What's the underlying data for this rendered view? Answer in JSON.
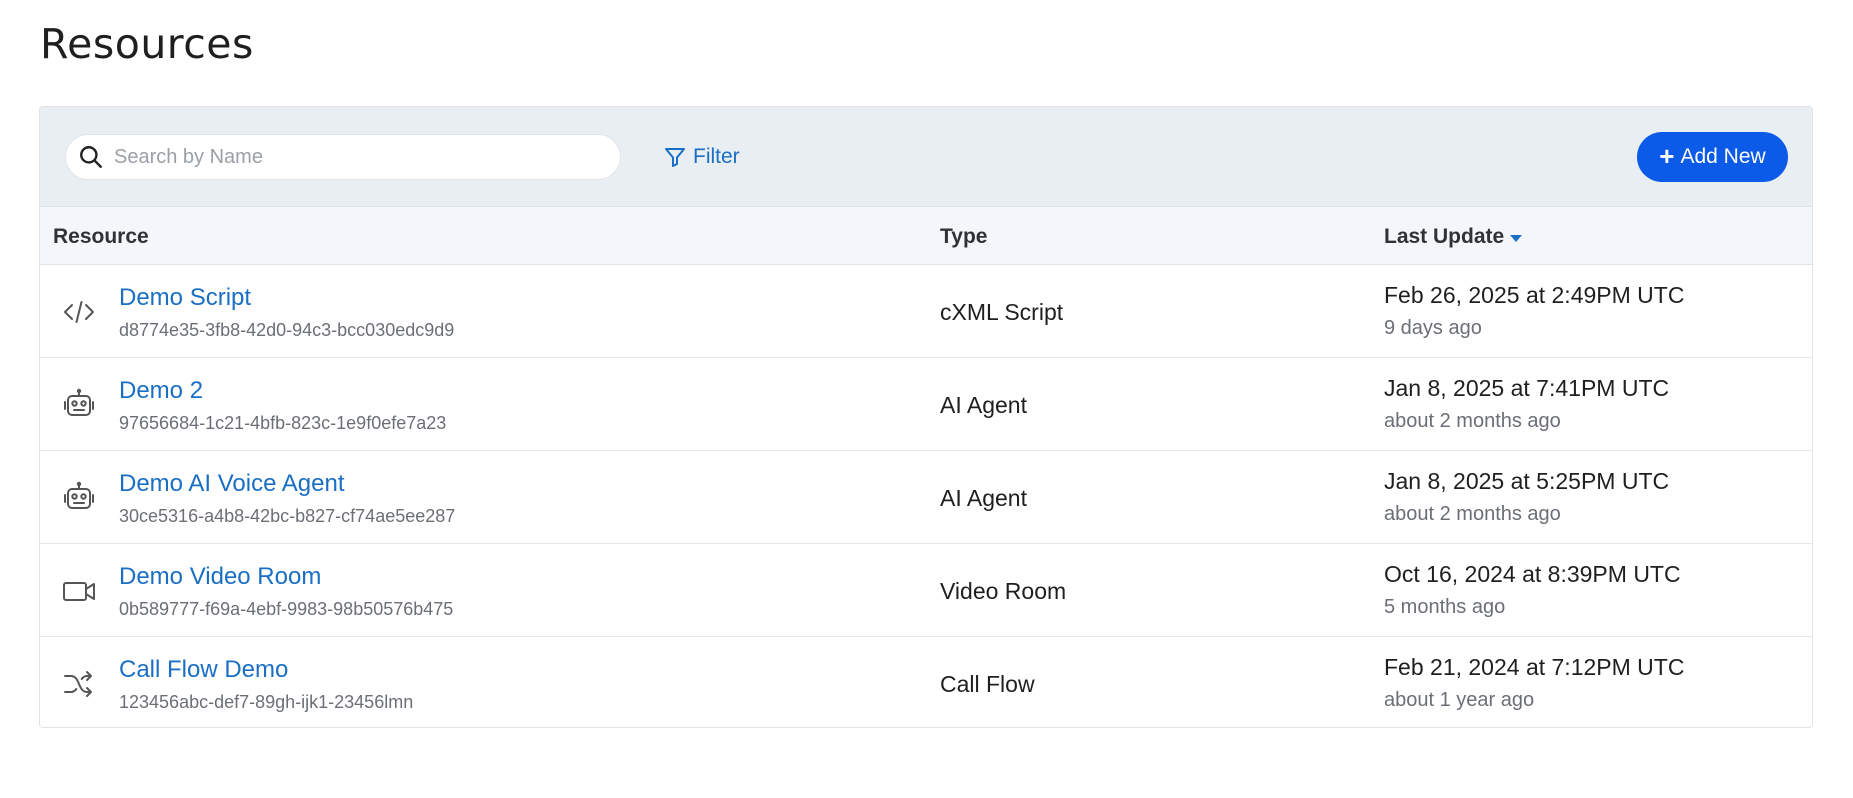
{
  "page": {
    "title": "Resources"
  },
  "toolbar": {
    "search_placeholder": "Search by Name",
    "search_value": "",
    "filter_label": "Filter",
    "add_label": "Add New",
    "add_icon": "+"
  },
  "table": {
    "columns": {
      "resource": "Resource",
      "type": "Type",
      "last_update": "Last Update"
    },
    "sort": {
      "column": "last_update",
      "direction": "descending"
    },
    "rows": [
      {
        "icon": "code-icon",
        "name": "Demo Script",
        "id": "d8774e35-3fb8-42d0-94c3-bcc030edc9d9",
        "type": "cXML Script",
        "date": "Feb 26, 2025 at 2:49PM UTC",
        "relative": "9 days ago"
      },
      {
        "icon": "robot-icon",
        "name": "Demo 2",
        "id": "97656684-1c21-4bfb-823c-1e9f0efe7a23",
        "type": "AI Agent",
        "date": "Jan 8, 2025 at 7:41PM UTC",
        "relative": "about 2 months ago"
      },
      {
        "icon": "robot-icon",
        "name": "Demo AI Voice Agent",
        "id": "30ce5316-a4b8-42bc-b827-cf74ae5ee287",
        "type": "AI Agent",
        "date": "Jan 8, 2025 at 5:25PM UTC",
        "relative": "about 2 months ago"
      },
      {
        "icon": "video-camera-icon",
        "name": "Demo Video Room",
        "id": "0b589777-f69a-4ebf-9983-98b50576b475",
        "type": "Video Room",
        "date": "Oct 16, 2024 at 8:39PM UTC",
        "relative": "5 months ago"
      },
      {
        "icon": "shuffle-icon",
        "name": "Call Flow Demo",
        "id": "123456abc-def7-89gh-ijk1-23456lmn",
        "type": "Call Flow",
        "date": "Feb 21, 2024 at 7:12PM UTC",
        "relative": "about 1 year ago"
      }
    ]
  },
  "colors": {
    "accent": "#0b5be8",
    "link": "#1a6fc4",
    "toolbar_bg": "#e8eef2",
    "header_bg": "#f3f6fa"
  }
}
